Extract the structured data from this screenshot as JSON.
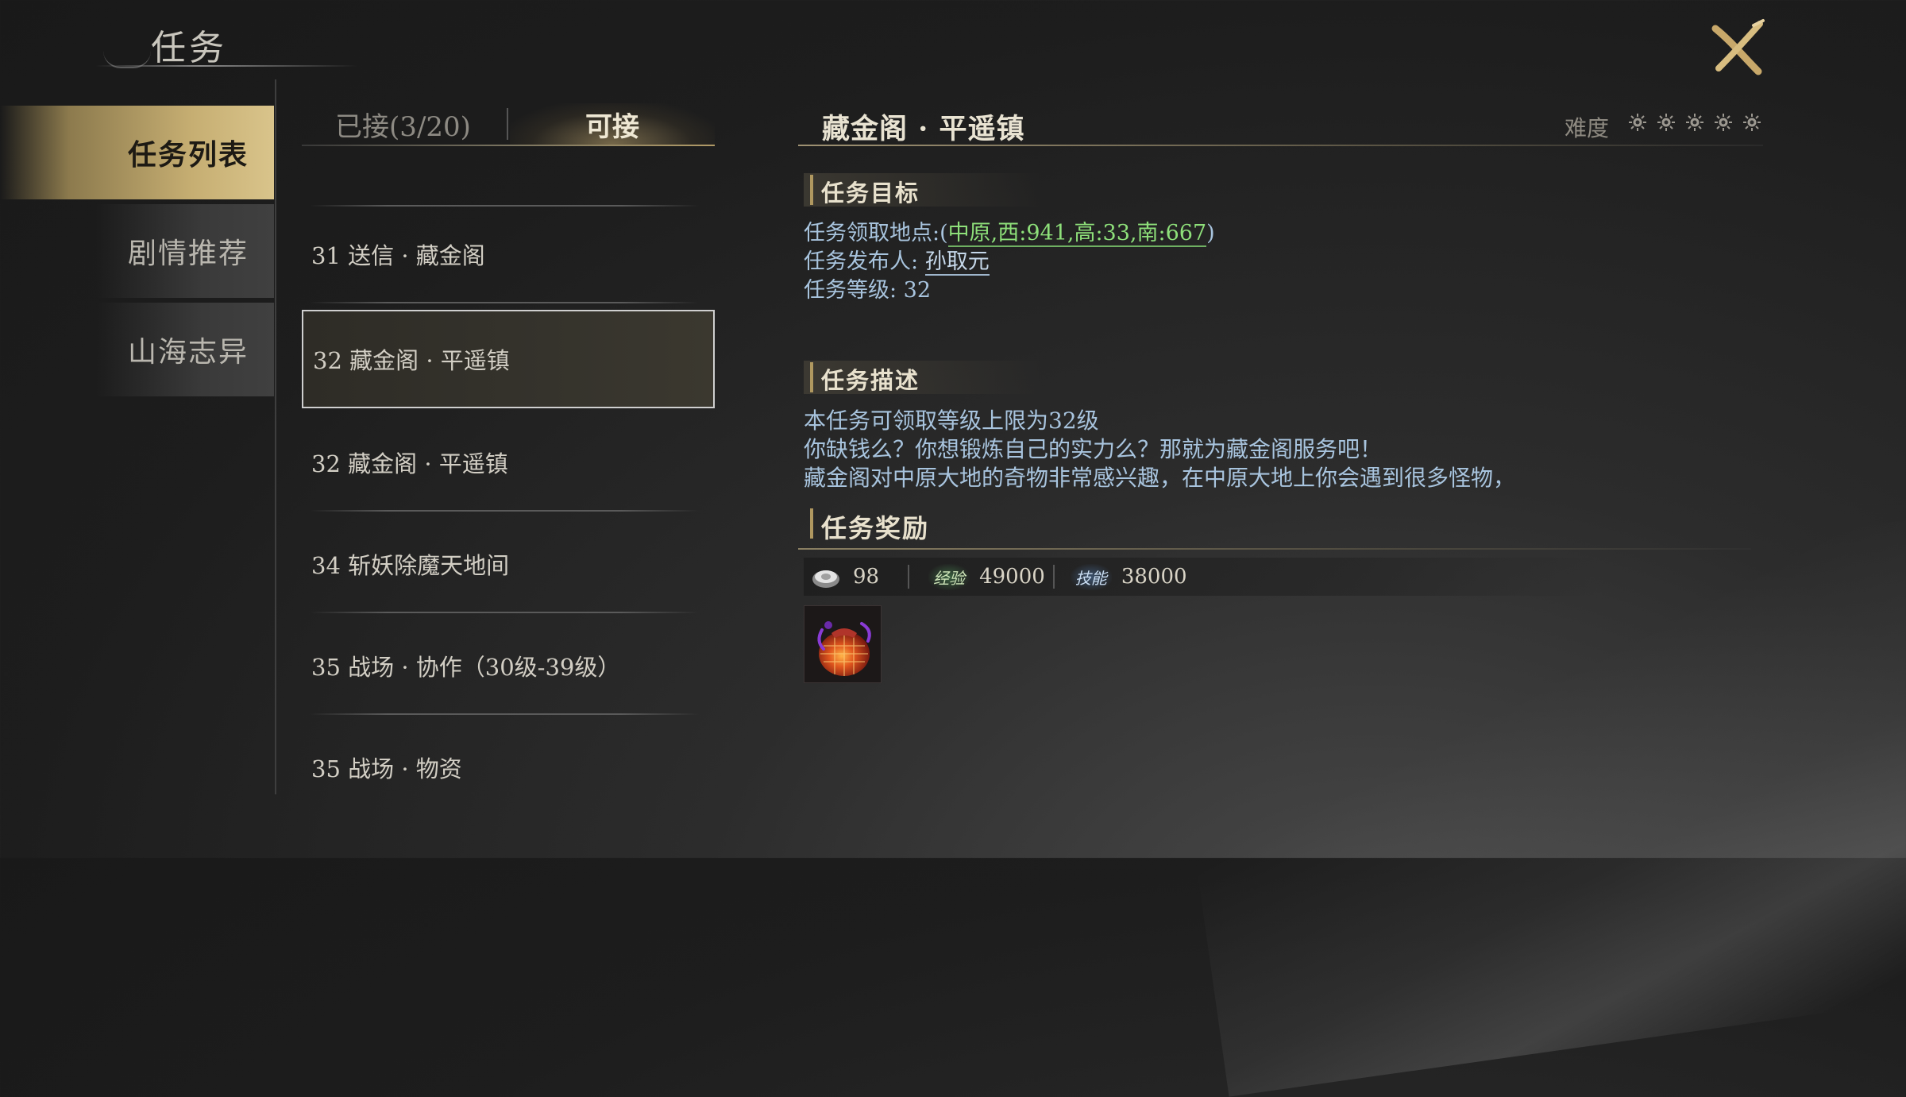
{
  "header": {
    "title": "任务"
  },
  "categories": [
    {
      "label": "任务列表",
      "active": true
    },
    {
      "label": "剧情推荐",
      "active": false
    },
    {
      "label": "山海志异",
      "active": false
    }
  ],
  "tabs": [
    {
      "label": "已接(3/20)",
      "active": false
    },
    {
      "label": "可接",
      "active": true
    }
  ],
  "quests": [
    {
      "label": "31 送信 · 藏金阁"
    },
    {
      "label": "32 藏金阁 · 平遥镇",
      "selected": true
    },
    {
      "label": "32 藏金阁 · 平遥镇"
    },
    {
      "label": "34 斩妖除魔天地间"
    },
    {
      "label": "35 战场 · 协作（30级-39级）"
    },
    {
      "label": "35 战场 · 物资"
    }
  ],
  "detail": {
    "title": "藏金阁 · 平遥镇",
    "difficulty_label": "难度",
    "difficulty_level": 5,
    "objective": {
      "heading": "任务目标",
      "location_label": "任务领取地点:",
      "location_value": "中原,西:941,高:33,南:667",
      "publisher_label": "任务发布人:",
      "publisher_value": "孙取元",
      "level_text": "任务等级: 32"
    },
    "description": {
      "heading": "任务描述",
      "lines": [
        "本任务可领取等级上限为32级",
        "你缺钱么？你想锻炼自己的实力么？那就为藏金阁服务吧！",
        "藏金阁对中原大地的奇物非常感兴趣，在中原大地上你会遇到很多怪物，"
      ]
    },
    "rewards": {
      "heading": "任务奖励",
      "silver": "98",
      "exp_tag": "经验",
      "exp": "49000",
      "skill_tag": "技能",
      "skill": "38000",
      "item_icon": "treasure-pouch-icon"
    }
  },
  "colors": {
    "accent_gold": "#c6ae72",
    "link_green": "#8ee07a",
    "text_blue": "#a8c4de"
  }
}
